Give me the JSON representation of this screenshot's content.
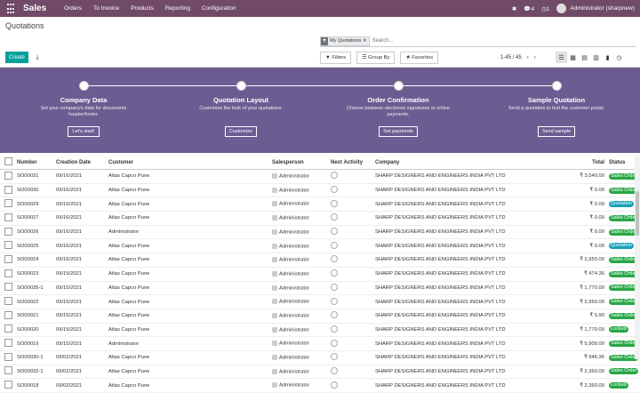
{
  "brand": "Sales",
  "menu": [
    "Orders",
    "To Invoice",
    "Products",
    "Reporting",
    "Configuration"
  ],
  "sys": {
    "chat_count": "4",
    "activity_count": "1",
    "user": "Administrator (sharpnew)"
  },
  "page_title": "Quotations",
  "search": {
    "facet": "My Quotations",
    "placeholder": "Search..."
  },
  "buttons": {
    "create": "Create",
    "filters": "Filters",
    "group_by": "Group By",
    "favorites": "Favorites"
  },
  "pager": "1-45 / 45",
  "steps": [
    {
      "title": "Company Data",
      "desc": "Set your company's data for documents header/footer.",
      "btn": "Let's start!"
    },
    {
      "title": "Quotation Layout",
      "desc": "Customize the look of your quotations.",
      "btn": "Customize"
    },
    {
      "title": "Order Confirmation",
      "desc": "Choose between electronic signatures or online payments.",
      "btn": "Set payments"
    },
    {
      "title": "Sample Quotation",
      "desc": "Send a quotation to test the customer portal.",
      "btn": "Send sample"
    }
  ],
  "columns": [
    "Number",
    "Creation Date",
    "Customer",
    "Salesperson",
    "Next Activity",
    "Company",
    "Total",
    "Status"
  ],
  "rows": [
    {
      "number": "SO00031",
      "date": "09/16/2021",
      "customer": "Atlas Capco Pune",
      "salesperson": "Administrator",
      "company": "SHARP DESIGNERS AND ENGINEERS INDIA PVT LTD",
      "total": "₹ 3,540.00",
      "status": "Sales Order"
    },
    {
      "number": "SO00030",
      "date": "09/16/2021",
      "customer": "Atlas Capco Pune",
      "salesperson": "Administrator",
      "company": "SHARP DESIGNERS AND ENGINEERS INDIA PVT LTD",
      "total": "₹ 0.00",
      "status": "Sales Order"
    },
    {
      "number": "SO00029",
      "date": "09/16/2021",
      "customer": "Atlas Capco Pune",
      "salesperson": "Administrator",
      "company": "SHARP DESIGNERS AND ENGINEERS INDIA PVT LTD",
      "total": "₹ 0.00",
      "status": "Quotation"
    },
    {
      "number": "SO00027",
      "date": "09/16/2021",
      "customer": "Atlas Capco Pune",
      "salesperson": "Administrator",
      "company": "SHARP DESIGNERS AND ENGINEERS INDIA PVT LTD",
      "total": "₹ 0.00",
      "status": "Sales Order"
    },
    {
      "number": "SO00026",
      "date": "09/16/2021",
      "customer": "Administrator",
      "salesperson": "Administrator",
      "company": "SHARP DESIGNERS AND ENGINEERS INDIA PVT LTD",
      "total": "₹ 0.00",
      "status": "Sales Order"
    },
    {
      "number": "SO00025",
      "date": "09/16/2021",
      "customer": "Atlas Capco Pune",
      "salesperson": "Administrator",
      "company": "SHARP DESIGNERS AND ENGINEERS INDIA PVT LTD",
      "total": "₹ 0.00",
      "status": "Quotation"
    },
    {
      "number": "SO00024",
      "date": "09/16/2021",
      "customer": "Atlas Capco Pune",
      "salesperson": "Administrator",
      "company": "SHARP DESIGNERS AND ENGINEERS INDIA PVT LTD",
      "total": "₹ 2,950.00",
      "status": "Sales Order"
    },
    {
      "number": "SO00023",
      "date": "09/15/2021",
      "customer": "Atlas Capco Pune",
      "salesperson": "Administrator",
      "company": "SHARP DESIGNERS AND ENGINEERS INDIA PVT LTD",
      "total": "₹ 474.36",
      "status": "Sales Order"
    },
    {
      "number": "SO00035-1",
      "date": "09/15/2021",
      "customer": "Atlas Capco Pune",
      "salesperson": "Administrator",
      "company": "SHARP DESIGNERS AND ENGINEERS INDIA PVT LTD",
      "total": "₹ 1,770.00",
      "status": "Sales Order"
    },
    {
      "number": "SO00022",
      "date": "09/15/2021",
      "customer": "Atlas Capco Pune",
      "salesperson": "Administrator",
      "company": "SHARP DESIGNERS AND ENGINEERS INDIA PVT LTD",
      "total": "₹ 2,950.00",
      "status": "Sales Order"
    },
    {
      "number": "SO00021",
      "date": "09/15/2021",
      "customer": "Atlas Capco Pune",
      "salesperson": "Administrator",
      "company": "SHARP DESIGNERS AND ENGINEERS INDIA PVT LTD",
      "total": "₹ 5.90",
      "status": "Sales Order"
    },
    {
      "number": "SO00020",
      "date": "09/15/2021",
      "customer": "Atlas Capco Pune",
      "salesperson": "Administrator",
      "company": "SHARP DESIGNERS AND ENGINEERS INDIA PVT LTD",
      "total": "₹ 1,770.00",
      "status": "Locked"
    },
    {
      "number": "SO00019",
      "date": "09/15/2021",
      "customer": "Administrator",
      "salesperson": "Administrator",
      "company": "SHARP DESIGNERS AND ENGINEERS INDIA PVT LTD",
      "total": "₹ 5,900.00",
      "status": "Sales Order"
    },
    {
      "number": "SO00030-1",
      "date": "09/02/2021",
      "customer": "Atlas Capco Pune",
      "salesperson": "Administrator",
      "company": "SHARP DESIGNERS AND ENGINEERS INDIA PVT LTD",
      "total": "₹ 946.36",
      "status": "Sales Order"
    },
    {
      "number": "SO00032-1",
      "date": "09/02/2021",
      "customer": "Atlas Capco Pune",
      "salesperson": "Administrator",
      "company": "SHARP DESIGNERS AND ENGINEERS INDIA PVT LTD",
      "total": "₹ 2,360.00",
      "status": "Sales Order"
    },
    {
      "number": "SO00018",
      "date": "09/02/2021",
      "customer": "Atlas Capco Pune",
      "salesperson": "Administrator",
      "company": "SHARP DESIGNERS AND ENGINEERS INDIA PVT LTD",
      "total": "₹ 2,360.00",
      "status": "Locked"
    }
  ]
}
